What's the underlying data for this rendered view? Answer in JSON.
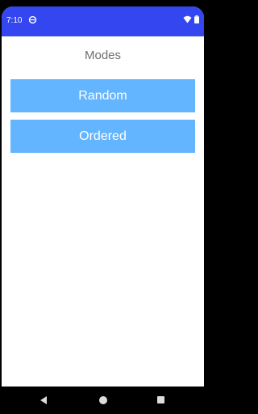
{
  "status_bar": {
    "time": "7:10",
    "icons": [
      "sync-icon",
      "wifi-icon",
      "battery-icon"
    ]
  },
  "main": {
    "title": "Modes",
    "buttons": [
      {
        "label": "Random"
      },
      {
        "label": "Ordered"
      }
    ]
  },
  "nav_bar": {
    "icons": [
      "back-icon",
      "home-icon",
      "recents-icon"
    ]
  },
  "colors": {
    "status_bar_bg": "#3346f0",
    "button_bg": "#64b5ff",
    "title_text": "#6f6f6f"
  }
}
